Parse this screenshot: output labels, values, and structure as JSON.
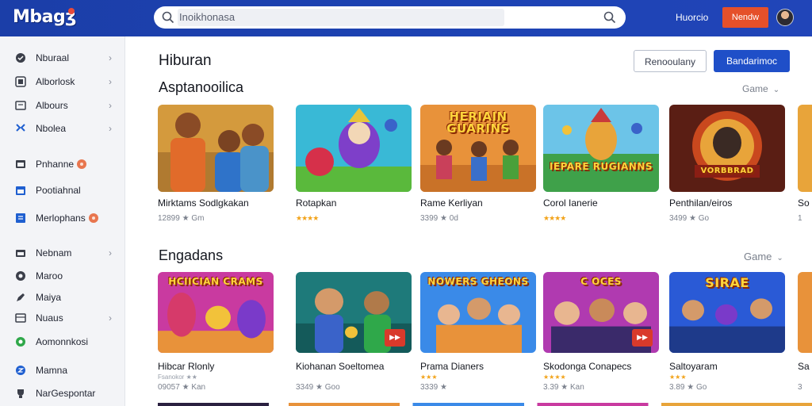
{
  "header": {
    "logo_text": "Mbagʒ",
    "search_placeholder": "Inoikhonasa",
    "link_label": "Huorcio",
    "button_label": "Nendw"
  },
  "sidebar": {
    "items": [
      {
        "label": "Nburaal",
        "icon": "check-circle-icon",
        "chevron": true
      },
      {
        "label": "Alborlosk",
        "icon": "grid-icon",
        "chevron": true
      },
      {
        "label": "Albours",
        "icon": "book-icon",
        "chevron": true
      },
      {
        "label": "Nbolea",
        "icon": "puzzle-icon",
        "chevron": true
      },
      {
        "label": "Pnhanne",
        "icon": "window-icon",
        "badge": true
      },
      {
        "label": "Pootiahnal",
        "icon": "calendar-icon"
      },
      {
        "label": "Merlophans",
        "icon": "list-icon",
        "badge": true
      },
      {
        "label": "Nebnam",
        "icon": "folder-icon",
        "chevron": true
      },
      {
        "label": "Maroo",
        "icon": "gamepad-icon"
      },
      {
        "label": "Maiya",
        "icon": "pencil-icon"
      },
      {
        "label": "Nuaus",
        "icon": "film-icon",
        "chevron": true
      },
      {
        "label": "Aomonnkosi",
        "icon": "green-circle-icon"
      },
      {
        "label": "Mamna",
        "icon": "blue-circle-icon"
      },
      {
        "label": "NarGespontar",
        "icon": "trophy-icon"
      }
    ]
  },
  "main": {
    "title": "Hiburan",
    "button_outline": "Renooulany",
    "button_primary": "Bandarimoc",
    "sections": [
      {
        "title": "Asptanooilica",
        "link": "Game",
        "cards": [
          {
            "title": "Mirktams Sodlgkakan",
            "meta": "12899 ★ Gm"
          },
          {
            "title": "Rotapkan",
            "meta": "★★★★"
          },
          {
            "title": "Rame Kerliyan",
            "meta": "3399 ★ 0d"
          },
          {
            "title": "Corol Ianerie",
            "meta": "★★★★"
          },
          {
            "title": "Penthilan/eiros",
            "meta": "3499 ★ Go"
          },
          {
            "title": "So",
            "meta": "1"
          }
        ],
        "banners": [
          "HERIAIN GUARINS",
          "IEPARE RUGIANNS",
          "VORBBRAD"
        ]
      },
      {
        "title": "Engadans",
        "link": "Game",
        "cards": [
          {
            "title": "Hibcar Rlonly",
            "sub": "Fsanokor ★★",
            "meta": "09057 ★ Kan"
          },
          {
            "title": "Kiohanan Soeltomea",
            "meta": "3349 ★ Goo"
          },
          {
            "title": "Prama Dianers",
            "sub": "★★★",
            "meta": "3339 ★"
          },
          {
            "title": "Skodonga Conapecs",
            "sub": "★★★★",
            "meta": "3.39 ★ Kan"
          },
          {
            "title": "Saltoyaram",
            "sub": "★★★",
            "meta": "3.89 ★ Go"
          },
          {
            "title": "Sa",
            "meta": "3"
          }
        ],
        "banners": [
          "HCIICIAN CRAMS",
          "NOWERS GHEONS",
          "C OCES",
          "SIRAE"
        ],
        "badges": [
          "▶▶",
          "▶▶"
        ]
      }
    ]
  },
  "colors": {
    "header_bg": "#1d43b4",
    "accent_orange": "#e5502a",
    "primary_blue": "#1f4fc8",
    "star_color": "#f2a31a"
  }
}
